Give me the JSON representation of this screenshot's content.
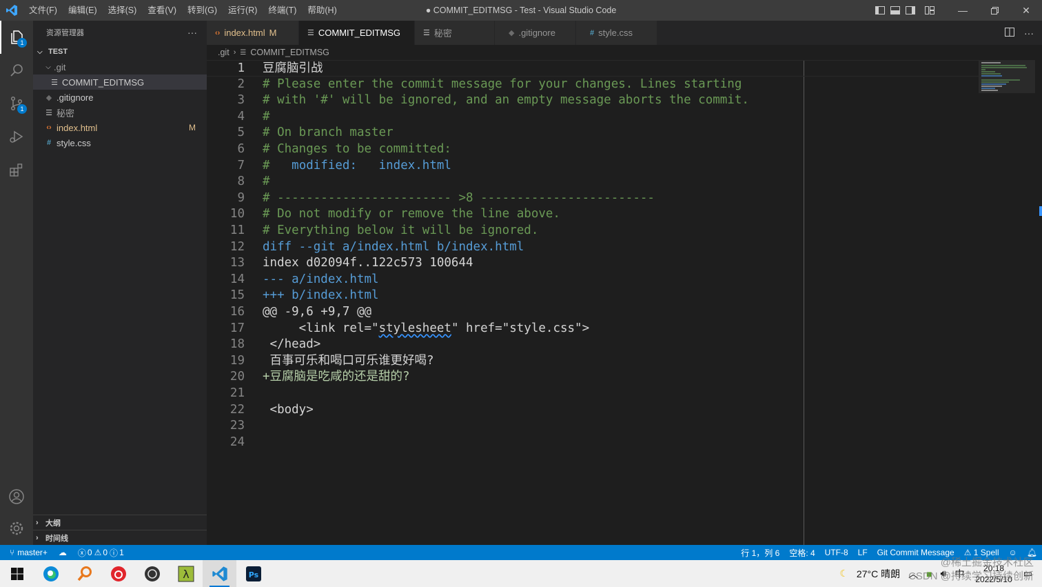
{
  "window": {
    "title": "● COMMIT_EDITMSG - Test - Visual Studio Code"
  },
  "menu": [
    "文件(F)",
    "编辑(E)",
    "选择(S)",
    "查看(V)",
    "转到(G)",
    "运行(R)",
    "终端(T)",
    "帮助(H)"
  ],
  "activity_bar": {
    "explorer_badge": "1",
    "scm_badge": "1"
  },
  "sidebar": {
    "header": "资源管理器",
    "more": "···",
    "section": "TEST",
    "tree": [
      {
        "label": ".git",
        "icon": "chevron-down",
        "badge": ""
      },
      {
        "label": "COMMIT_EDITMSG",
        "icon": "lines",
        "badge": ""
      },
      {
        "label": ".gitignore",
        "icon": "diamond",
        "badge": ""
      },
      {
        "label": "秘密",
        "icon": "lines",
        "badge": ""
      },
      {
        "label": "index.html",
        "icon": "html",
        "badge": "M"
      },
      {
        "label": "style.css",
        "icon": "hash",
        "badge": ""
      }
    ],
    "outline": "大纲",
    "timeline": "时间线"
  },
  "tabs": [
    {
      "label": "index.html",
      "badge": "M"
    },
    {
      "label": "COMMIT_EDITMSG",
      "badge": ""
    },
    {
      "label": "秘密",
      "badge": ""
    },
    {
      "label": ".gitignore",
      "badge": ""
    },
    {
      "label": "style.css",
      "badge": ""
    }
  ],
  "breadcrumb": [
    ".git",
    "COMMIT_EDITMSG"
  ],
  "editor": {
    "line_numbers": [
      "1",
      "2",
      "3",
      "4",
      "5",
      "6",
      "7",
      "8",
      "9",
      "10",
      "11",
      "12",
      "13",
      "14",
      "15",
      "16",
      "17",
      "18",
      "19",
      "20",
      "21",
      "22",
      "23",
      "24"
    ],
    "lines": [
      "豆腐脑引战",
      "# Please enter the commit message for your changes. Lines starting",
      "# with '#' will be ignored, and an empty message aborts the commit.",
      "#",
      "# On branch master",
      "# Changes to be committed:",
      "#",
      "#",
      "# ------------------------ >8 ------------------------",
      "# Do not modify or remove the line above.",
      "# Everything below it will be ignored.",
      "diff --git a/index.html b/index.html",
      "index d02094f..122c573 100644",
      "--- a/index.html",
      "+++ b/index.html",
      "@@ -9,6 +9,7 @@",
      "     <link rel=\"",
      " </head>",
      " 百事可乐和喝口可乐谁更好喝?",
      "+豆腐脑是吃咸的还是甜的?",
      "",
      " <body>",
      "",
      ""
    ],
    "line7_modified": "modified:",
    "line7_file": "index.html",
    "line17_stylesheet": "stylesheet",
    "line17_rest": "\" href=\"style.css\">"
  },
  "statusbar": {
    "branch": "master+",
    "errors": "0",
    "warnings": "0",
    "info": "0",
    "info2": "1",
    "position": "行 1，列 6",
    "spaces": "空格: 4",
    "encoding": "UTF-8",
    "eol": "LF",
    "language": "Git Commit Message",
    "spell": "1 Spell"
  },
  "taskbar": {
    "weather": "27°C 晴朗",
    "ime": "中",
    "time": "20:18",
    "date": "2022/5/10"
  },
  "watermark": {
    "line1": "@稀土掘金技术社区",
    "line2": "CSDN @持续学习持续创新"
  },
  "colors": {
    "accent": "#007acc",
    "comment": "#6a9955",
    "keyword": "#569cd6",
    "modified": "#e2c08d"
  }
}
